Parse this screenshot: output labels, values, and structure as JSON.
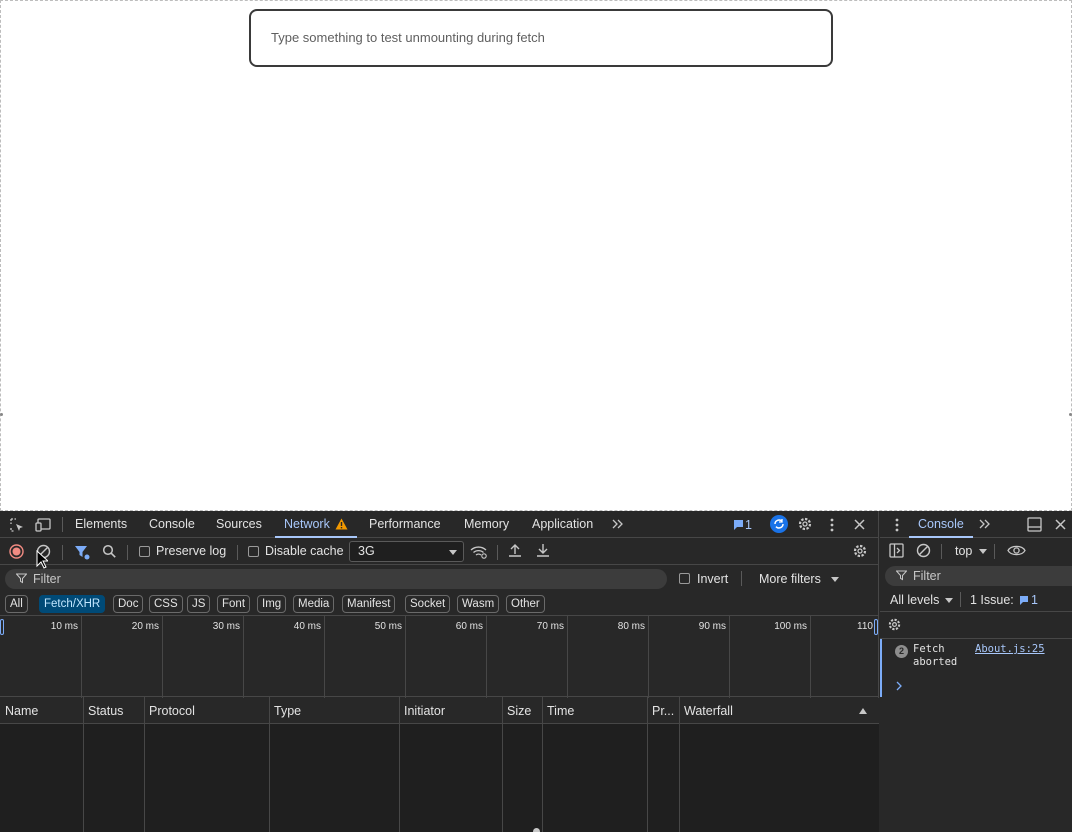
{
  "page": {
    "input_placeholder": "Type something to test unmounting during fetch"
  },
  "devtools": {
    "tabs": [
      {
        "label": "Elements"
      },
      {
        "label": "Console"
      },
      {
        "label": "Sources"
      },
      {
        "label": "Network",
        "active": true,
        "warning": true
      },
      {
        "label": "Performance"
      },
      {
        "label": "Memory"
      },
      {
        "label": "Application"
      }
    ],
    "issues_badge": "1",
    "toolbar": {
      "preserve_log": "Preserve log",
      "disable_cache": "Disable cache",
      "throttle": "3G"
    },
    "filter": {
      "placeholder": "Filter",
      "invert": "Invert",
      "more_filters": "More filters"
    },
    "type_filters": [
      "All",
      "Fetch/XHR",
      "Doc",
      "CSS",
      "JS",
      "Font",
      "Img",
      "Media",
      "Manifest",
      "Socket",
      "Wasm",
      "Other"
    ],
    "active_type_filter": "Fetch/XHR",
    "overview_ticks": [
      "10 ms",
      "20 ms",
      "30 ms",
      "40 ms",
      "50 ms",
      "60 ms",
      "70 ms",
      "80 ms",
      "90 ms",
      "100 ms",
      "110"
    ],
    "columns": [
      "Name",
      "Status",
      "Protocol",
      "Type",
      "Initiator",
      "Size",
      "Time",
      "Pr...",
      "Waterfall"
    ]
  },
  "drawer": {
    "tab": "Console",
    "context": "top",
    "filter_placeholder": "Filter",
    "levels": "All levels",
    "issues": "1 Issue:",
    "issues_count": "1",
    "messages": [
      {
        "count": "2",
        "text": "Fetch\naborted",
        "source": "About.js:25"
      }
    ]
  },
  "colors": {
    "accent": "#a8c7fa",
    "record": "#f28b82",
    "active_filter_bg": "#004a77",
    "warning": "#f29900",
    "panel_bg": "#282828"
  }
}
